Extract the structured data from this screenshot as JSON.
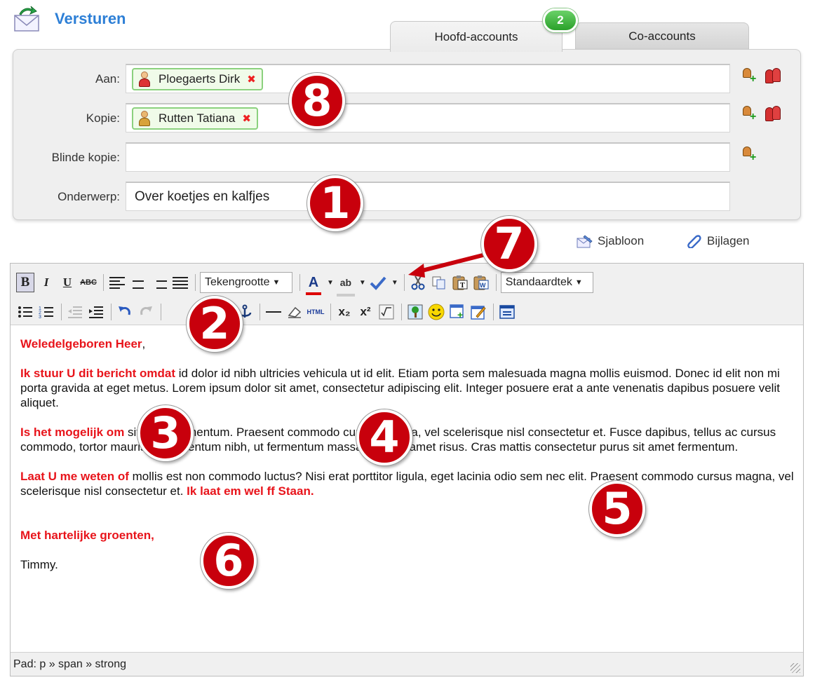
{
  "header": {
    "title": "Versturen"
  },
  "tabs": [
    {
      "label": "Hoofd-accounts",
      "active": true
    },
    {
      "label": "Co-accounts",
      "active": false
    }
  ],
  "badge_count": "2",
  "recipients": {
    "to_label": "Aan:",
    "to_chip": "Ploegaerts Dirk",
    "cc_label": "Kopie:",
    "cc_chip": "Rutten Tatiana",
    "bcc_label": "Blinde kopie:",
    "subject_label": "Onderwerp:",
    "subject_value": "Over koetjes en kalfjes"
  },
  "links": {
    "template": "Sjabloon",
    "attachments": "Bijlagen"
  },
  "toolbar": {
    "bold": "B",
    "italic": "I",
    "underline": "U",
    "strike": "ABC",
    "font_size_select": "Tekengrootte",
    "font_color": "A",
    "highlight": "ab",
    "style_select": "Standaardtek",
    "subscript": "x₂",
    "superscript": "x²",
    "html": "HTML"
  },
  "message": {
    "p1_red": "Weledelgeboren Heer",
    "p1_rest": ",",
    "p2_red": "Ik stuur U dit bericht omdat",
    "p2_rest": " id dolor id nibh ultricies vehicula ut id elit. Etiam porta sem malesuada magna mollis euismod. Donec id elit non mi porta gravida at eget metus. Lorem ipsum dolor sit amet, consectetur adipiscing elit. Integer posuere erat a ante venenatis dapibus posuere velit aliquet.",
    "p3_red": "Is het mogelijk om",
    "p3_rest": " sit amet fermentum. Praesent commodo cursus magna, vel scelerisque nisl consectetur et. Fusce dapibus, tellus ac cursus commodo, tortor mauris condimentum nibh, ut fermentum massa justo sit amet risus. Cras mattis consectetur purus sit amet fermentum.",
    "p4_red": "Laat U me weten of",
    "p4_rest": " mollis est non commodo luctus? Nisi erat porttitor ligula, eget lacinia odio sem nec elit. Praesent commodo cursus magna, vel scelerisque nisl consectetur et. ",
    "p4_red_end": "Ik laat em wel ff Staan.",
    "p5_red": "Met hartelijke groenten,",
    "p6": "Timmy."
  },
  "statusbar": {
    "path": "Pad: p » span » strong"
  },
  "callouts": [
    "1",
    "2",
    "3",
    "4",
    "5",
    "6",
    "7",
    "8"
  ],
  "colors": {
    "accent_blue": "#2d7fd6",
    "emphasis_red": "#e8141b",
    "callout_red": "#c8000c",
    "chip_green": "#8bd17e"
  }
}
